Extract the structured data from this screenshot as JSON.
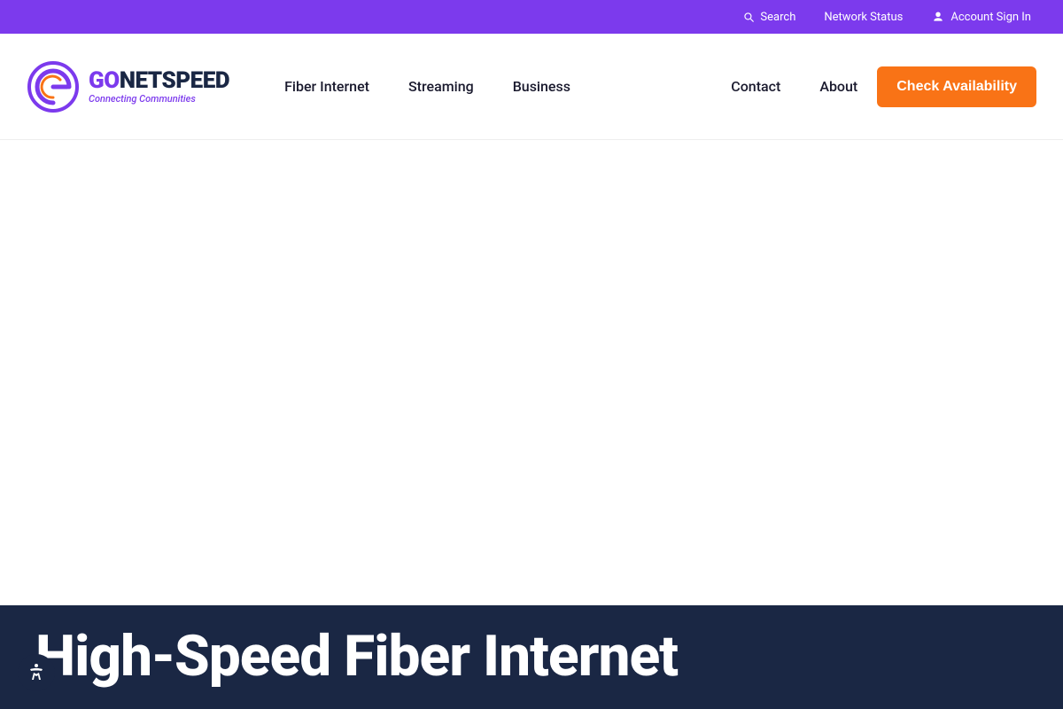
{
  "top_bar": {
    "search_label": "Search",
    "network_status_label": "Network Status",
    "account_sign_in_label": "Account Sign In"
  },
  "nav": {
    "logo_go": "GO",
    "logo_netspeed": "NETSPEED",
    "logo_tagline": "Connecting Communities",
    "links": [
      {
        "label": "Fiber Internet",
        "name": "fiber-internet"
      },
      {
        "label": "Streaming",
        "name": "streaming"
      },
      {
        "label": "Business",
        "name": "business"
      },
      {
        "label": "Contact",
        "name": "contact"
      },
      {
        "label": "About",
        "name": "about"
      }
    ],
    "cta_button": "Check Availability"
  },
  "hero": {
    "heading": "High-Speed Fiber Internet"
  },
  "accessibility": {
    "label": "Accessibility"
  }
}
